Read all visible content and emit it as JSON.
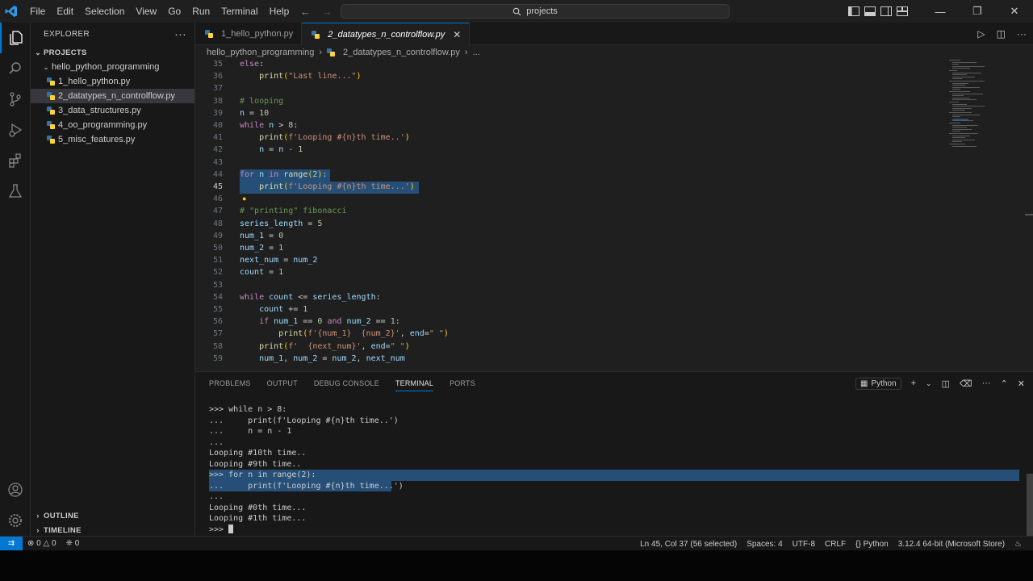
{
  "titlebar": {
    "menu": [
      "File",
      "Edit",
      "Selection",
      "View",
      "Go",
      "Run",
      "Terminal",
      "Help"
    ],
    "search_label": "projects"
  },
  "sidebar": {
    "header": "EXPLORER",
    "section": "PROJECTS",
    "folder": "hello_python_programming",
    "files": [
      "1_hello_python.py",
      "2_datatypes_n_controlflow.py",
      "3_data_structures.py",
      "4_oo_programming.py",
      "5_misc_features.py"
    ],
    "selected_index": 1,
    "outline": "OUTLINE",
    "timeline": "TIMELINE"
  },
  "editor": {
    "tabs": [
      {
        "label": "1_hello_python.py",
        "active": false
      },
      {
        "label": "2_datatypes_n_controlflow.py",
        "active": true
      }
    ],
    "breadcrumb": [
      "hello_python_programming",
      "2_datatypes_n_controlflow.py",
      "..."
    ],
    "lines": [
      {
        "n": "35",
        "text": "else:"
      },
      {
        "n": "36",
        "text": "    print(\"Last line...\")"
      },
      {
        "n": "37",
        "text": ""
      },
      {
        "n": "38",
        "text": "# looping"
      },
      {
        "n": "39",
        "text": "n = 10"
      },
      {
        "n": "40",
        "text": "while n > 8:"
      },
      {
        "n": "41",
        "text": "    print(f'Looping #{n}th time..')"
      },
      {
        "n": "42",
        "text": "    n = n - 1"
      },
      {
        "n": "43",
        "text": ""
      },
      {
        "n": "44",
        "text": "for n in range(2):"
      },
      {
        "n": "45",
        "text": "    print(f'Looping #{n}th time...')"
      },
      {
        "n": "46",
        "text": ""
      },
      {
        "n": "47",
        "text": "# \"printing\" fibonacci"
      },
      {
        "n": "48",
        "text": "series_length = 5"
      },
      {
        "n": "49",
        "text": "num_1 = 0"
      },
      {
        "n": "50",
        "text": "num_2 = 1"
      },
      {
        "n": "51",
        "text": "next_num = num_2"
      },
      {
        "n": "52",
        "text": "count = 1"
      },
      {
        "n": "53",
        "text": ""
      },
      {
        "n": "54",
        "text": "while count <= series_length:"
      },
      {
        "n": "55",
        "text": "    count += 1"
      },
      {
        "n": "56",
        "text": "    if num_1 == 0 and num_2 == 1:"
      },
      {
        "n": "57",
        "text": "        print(f'{num_1}  {num_2}', end=\" \")"
      },
      {
        "n": "58",
        "text": "    print(f'  {next_num}', end=\" \")"
      },
      {
        "n": "59",
        "text": "    num_1, num_2 = num_2, next_num"
      }
    ]
  },
  "panel": {
    "tabs": [
      "PROBLEMS",
      "OUTPUT",
      "DEBUG CONSOLE",
      "TERMINAL",
      "PORTS"
    ],
    "active_tab": "TERMINAL",
    "terminal_profile": "Python",
    "terminal_lines": [
      ">>> while n > 8:",
      "...     print(f'Looping #{n}th time..')",
      "...     n = n - 1",
      "...",
      "Looping #10th time..",
      "Looping #9th time..",
      ">>> for n in range(2):",
      "...     print(f'Looping #{n}th time...')",
      "...",
      "Looping #0th time...",
      "Looping #1th time...",
      ">>> "
    ]
  },
  "statusbar": {
    "errors": "0",
    "warnings": "0",
    "ports": "0",
    "position": "Ln 45, Col 37 (56 selected)",
    "spaces": "Spaces: 4",
    "encoding": "UTF-8",
    "eol": "CRLF",
    "language": "Python",
    "interpreter": "3.12.4 64-bit (Microsoft Store)"
  },
  "colors": {
    "accent": "#0078d4",
    "selection": "#264f78",
    "keyword": "#c586c0",
    "string": "#ce9178",
    "comment": "#6a9955"
  }
}
